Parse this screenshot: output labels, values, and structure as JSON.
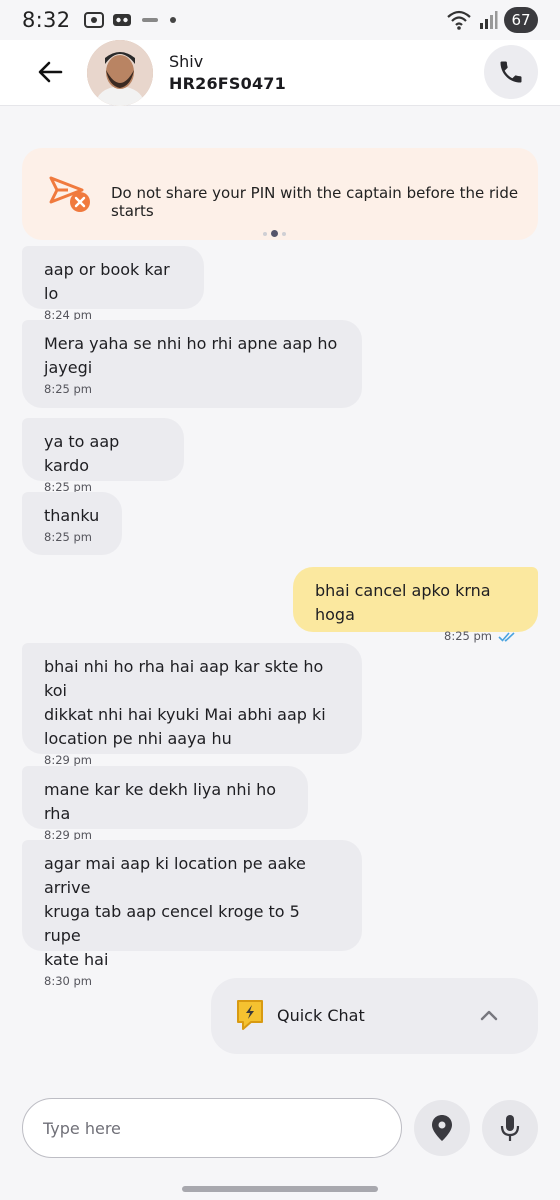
{
  "status_bar": {
    "time": "8:32",
    "battery": "67"
  },
  "header": {
    "driver_name": "Shiv",
    "vehicle_number": "HR26FS0471"
  },
  "banner": {
    "text": "Do not share your PIN with the captain before the ride starts"
  },
  "messages": [
    {
      "direction": "in",
      "lines": [
        "aap or book kar lo"
      ],
      "time": "8:24 pm"
    },
    {
      "direction": "in",
      "lines": [
        "Mera yaha se nhi ho rhi apne aap ho",
        "jayegi"
      ],
      "time": "8:25 pm"
    },
    {
      "direction": "in",
      "lines": [
        "ya to aap kardo"
      ],
      "time": "8:25 pm"
    },
    {
      "direction": "in",
      "lines": [
        "thanku"
      ],
      "time": "8:25 pm"
    },
    {
      "direction": "out",
      "lines": [
        "bhai cancel apko krna hoga"
      ],
      "time": "8:25 pm",
      "status": "read"
    },
    {
      "direction": "in",
      "lines": [
        "bhai nhi ho rha hai aap kar skte ho koi",
        "dikkat nhi hai kyuki Mai abhi aap ki",
        "location pe nhi aaya hu"
      ],
      "time": "8:29 pm"
    },
    {
      "direction": "in",
      "lines": [
        "mane kar ke dekh liya nhi ho rha"
      ],
      "time": "8:29 pm"
    },
    {
      "direction": "in",
      "lines": [
        "agar mai aap ki location pe aake arrive",
        "kruga tab aap cencel kroge to 5 rupe",
        "kate hai"
      ],
      "time": "8:30 pm"
    }
  ],
  "quick_chat": {
    "label": "Quick Chat"
  },
  "composer": {
    "placeholder": "Type here"
  },
  "colors": {
    "incoming_bubble": "#ebebef",
    "outgoing_bubble": "#fbe89f",
    "banner_bg": "#fdf0e8",
    "banner_icon": "#f07a3e",
    "read_ticks": "#4aa3df"
  }
}
